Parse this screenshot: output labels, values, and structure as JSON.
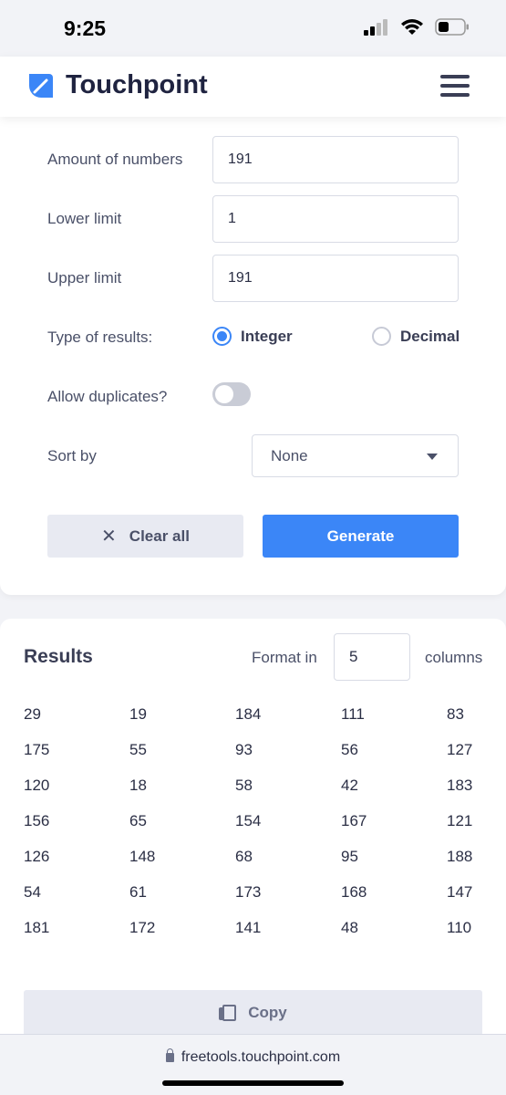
{
  "status_bar": {
    "time": "9:25",
    "signal_icon": "cellular-signal-icon",
    "wifi_icon": "wifi-icon",
    "battery_icon": "battery-icon"
  },
  "header": {
    "logo_icon": "touchpoint-logo-icon",
    "brand": "Touchpoint",
    "menu_icon": "hamburger-menu-icon"
  },
  "form": {
    "amount_label": "Amount of numbers",
    "amount_value": "191",
    "lower_label": "Lower limit",
    "lower_value": "1",
    "upper_label": "Upper limit",
    "upper_value": "191",
    "type_label": "Type of results:",
    "type_options": [
      {
        "label": "Integer",
        "selected": true
      },
      {
        "label": "Decimal",
        "selected": false
      }
    ],
    "duplicates_label": "Allow duplicates?",
    "duplicates_on": false,
    "sort_label": "Sort by",
    "sort_value": "None",
    "clear_label": "Clear all",
    "generate_label": "Generate",
    "accent_color": "#3b86f7"
  },
  "results": {
    "title": "Results",
    "format_label": "Format in",
    "columns_value": "5",
    "columns_label": "columns",
    "rows": [
      [
        "29",
        "19",
        "184",
        "111",
        "83"
      ],
      [
        "175",
        "55",
        "93",
        "56",
        "127"
      ],
      [
        "120",
        "18",
        "58",
        "42",
        "183"
      ],
      [
        "156",
        "65",
        "154",
        "167",
        "121"
      ],
      [
        "126",
        "148",
        "68",
        "95",
        "188"
      ],
      [
        "54",
        "61",
        "173",
        "168",
        "147"
      ],
      [
        "181",
        "172",
        "141",
        "48",
        "110"
      ]
    ],
    "copy_label": "Copy"
  },
  "browser": {
    "url": "freetools.touchpoint.com"
  }
}
